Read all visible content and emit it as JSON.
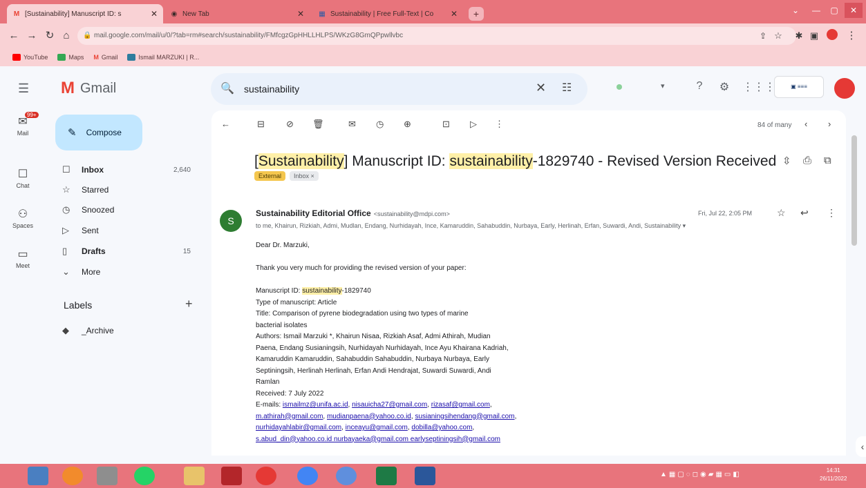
{
  "browser": {
    "tabs": [
      {
        "title": "[Sustainability] Manuscript ID: s",
        "icon": "gmail-icon",
        "active": true
      },
      {
        "title": "New Tab",
        "icon": "chrome-icon",
        "active": false
      },
      {
        "title": "Sustainability | Free Full-Text | Co",
        "icon": "mdpi-icon",
        "active": false
      }
    ],
    "address": "mail.google.com/mail/u/0/?tab=rm#search/sustainability/FMfcgzGpHHLLHLPS/WKzG8GmQPpwllvbc",
    "bookmarks": [
      {
        "label": "YouTube",
        "color": "#ff0000"
      },
      {
        "label": "Maps",
        "color": "#34a853"
      },
      {
        "label": "Gmail",
        "color": "#ea4335"
      },
      {
        "label": "Ismail MARZUKI | R...",
        "color": "#2e7d9e"
      }
    ]
  },
  "gmail": {
    "product": "Gmail",
    "search_value": "sustainability",
    "rail": [
      {
        "label": "Mail",
        "icon": "mail-icon"
      },
      {
        "label": "Chat",
        "icon": "chat-icon"
      },
      {
        "label": "Spaces",
        "icon": "spaces-icon"
      },
      {
        "label": "Meet",
        "icon": "meet-icon"
      }
    ],
    "mail_badge": "99+",
    "compose": "Compose",
    "nav": [
      {
        "label": "Inbox",
        "count": "2,640",
        "icon": "inbox-icon",
        "bold": true
      },
      {
        "label": "Starred",
        "count": "",
        "icon": "star-icon",
        "bold": false
      },
      {
        "label": "Snoozed",
        "count": "",
        "icon": "clock-icon",
        "bold": false
      },
      {
        "label": "Sent",
        "count": "",
        "icon": "send-icon",
        "bold": false
      },
      {
        "label": "Drafts",
        "count": "15",
        "icon": "draft-icon",
        "bold": true
      },
      {
        "label": "More",
        "count": "",
        "icon": "chevron-down-icon",
        "bold": false
      }
    ],
    "labels_title": "Labels",
    "labels": [
      {
        "label": "_Archive"
      }
    ],
    "pager": "84 of many",
    "subject_parts": [
      "[",
      "Sustainability",
      "] Manuscript ID: ",
      "sustainability",
      "-1829740 - Revised Version Received"
    ],
    "label_external": "External",
    "label_inbox": "Inbox ×",
    "sender_initial": "S",
    "sender_name": "Sustainability Editorial Office",
    "sender_email": "<sustainability@mdpi.com>",
    "recipients": "to me, Khairun, Rizkiah, Admi, Mudlan, Endang, Nurhidayah, Ince, Kamaruddin, Sahabuddin, Nurbaya, Early, Herlinah, Erfan, Suwardi, Andi, Sustainability ▾",
    "date": "Fri, Jul 22, 2:05 PM",
    "body": {
      "greeting": "Dear Dr. Marzuki,",
      "thanks": "Thank you very much for providing the revised version of your paper:",
      "ms_id_prefix": "Manuscript ID: ",
      "ms_id_hl": "sustainability",
      "ms_id_suffix": "-1829740",
      "type": "Type of manuscript: Article",
      "title1": "Title: Comparison of pyrene biodegradation using two types of marine",
      "title2": "bacterial isolates",
      "authors1": "Authors: Ismail Marzuki *, Khairun Nisaa, Rizkiah Asaf, Admi Athirah, Mudian",
      "authors2": "Paena, Endang Susianingsih, Nurhidayah Nurhidayah, Ince Ayu Khairana Kadriah,",
      "authors3": "Kamaruddin Kamaruddin, Sahabuddin Sahabuddin, Nurbaya Nurbaya, Early",
      "authors4": "Septiningsih, Herlinah Herlinah, Erfan Andi Hendrajat, Suwardi Suwardi, Andi",
      "authors5": "Ramlan",
      "received": "Received: 7 July 2022",
      "emails_prefix": "E-mails: ",
      "email1": "ismailmz@unifa.ac.id",
      "email2": "nisauicha27@gmail.com",
      "email3": "rizasaf@gmail.com",
      "email4": "m.athirah@gmail.com",
      "email5": "mudianpaena@yahoo.co.id",
      "email6": "susianingsihendang@gmail.com",
      "email7": "nurhidayahlabir@gmail.com",
      "email8": "inceayu@gmail.com",
      "email9": "dobilla@yahoo.com",
      "email_last": "s.abud_din@yahoo.co.id  nurbayaeka@gmail.com  earlyseptiningsih@gmail.com"
    }
  },
  "taskbar": {
    "clock_time": "14:31",
    "clock_date": "26/11/2022"
  }
}
